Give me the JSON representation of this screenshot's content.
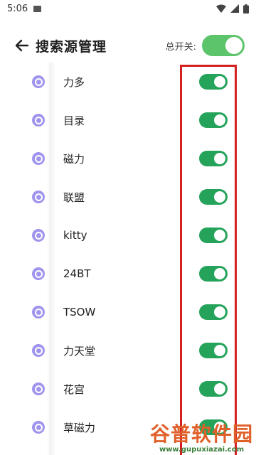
{
  "status_bar": {
    "time": "5:06"
  },
  "header": {
    "title": "搜索源管理",
    "master_label": "总开关:"
  },
  "sources": [
    {
      "name": "力多",
      "enabled": true
    },
    {
      "name": "目录",
      "enabled": true
    },
    {
      "name": "磁力",
      "enabled": true
    },
    {
      "name": "联盟",
      "enabled": true
    },
    {
      "name": "kitty",
      "enabled": true
    },
    {
      "name": "24BT",
      "enabled": true
    },
    {
      "name": "TSOW",
      "enabled": true
    },
    {
      "name": "力天堂",
      "enabled": true
    },
    {
      "name": "花宫",
      "enabled": true
    },
    {
      "name": "草磁力",
      "enabled": true
    }
  ],
  "watermark": {
    "title": "谷普软件园",
    "url": "www.gupuxiazai.com"
  },
  "colors": {
    "toggle_on": "#25a35a",
    "master_toggle": "#5cc46a",
    "source_icon": "#9f95ee",
    "highlight": "#d31f1f"
  }
}
